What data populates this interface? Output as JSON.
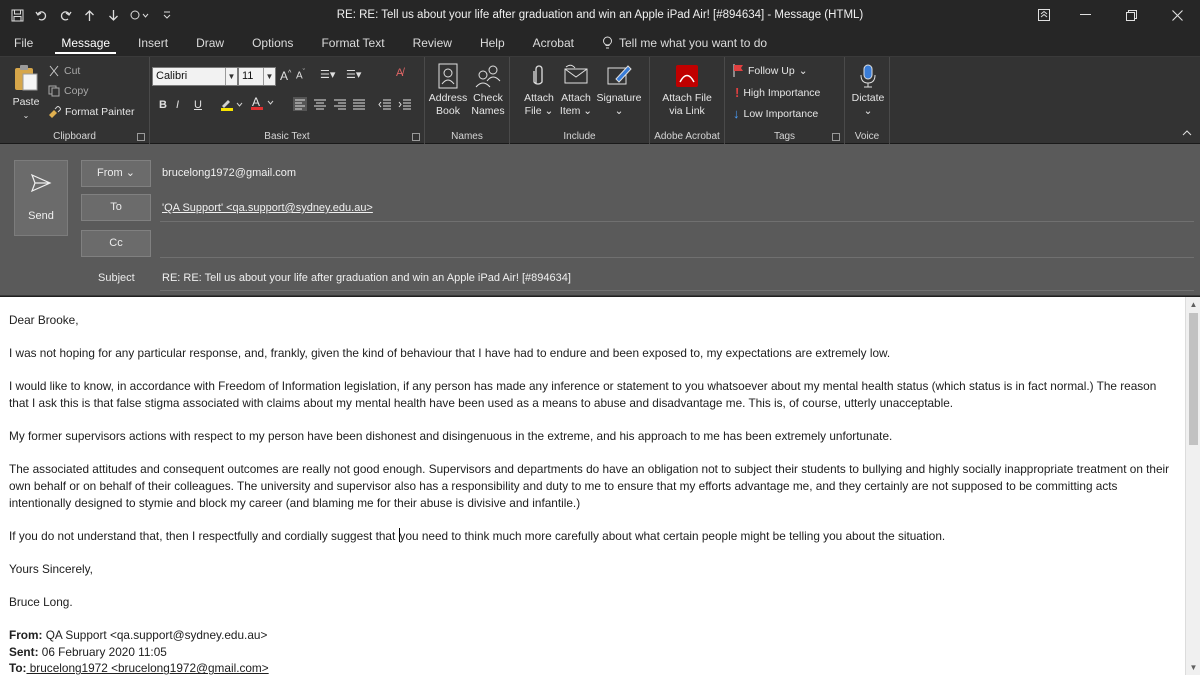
{
  "window": {
    "title": "RE: RE: Tell us about your life after graduation and win an Apple iPad Air! [#894634]  -  Message (HTML)"
  },
  "tabs": [
    "File",
    "Message",
    "Insert",
    "Draw",
    "Options",
    "Format Text",
    "Review",
    "Help",
    "Acrobat"
  ],
  "active_tab": "Message",
  "tell_me": "Tell me what you want to do",
  "ribbon": {
    "clipboard": {
      "paste": "Paste",
      "cut": "Cut",
      "copy": "Copy",
      "format_painter": "Format Painter",
      "label": "Clipboard"
    },
    "basic_text": {
      "font": "Calibri",
      "size": "11",
      "label": "Basic Text"
    },
    "names": {
      "address_book_1": "Address",
      "address_book_2": "Book",
      "check_names_1": "Check",
      "check_names_2": "Names",
      "label": "Names"
    },
    "include": {
      "attach_file_1": "Attach",
      "attach_file_2": "File",
      "attach_item_1": "Attach",
      "attach_item_2": "Item",
      "signature": "Signature",
      "label": "Include"
    },
    "adobe": {
      "attach_link_1": "Attach File",
      "attach_link_2": "via Link",
      "label": "Adobe Acrobat"
    },
    "tags": {
      "follow_up": "Follow Up",
      "high": "High Importance",
      "low": "Low Importance",
      "label": "Tags"
    },
    "voice": {
      "dictate": "Dictate",
      "label": "Voice"
    }
  },
  "header": {
    "send": "Send",
    "from_label": "From",
    "from_value": "brucelong1972@gmail.com",
    "to_label": "To",
    "to_value": "'QA Support' <qa.support@sydney.edu.au>",
    "cc_label": "Cc",
    "subject_label": "Subject",
    "subject_value": "RE: RE: Tell us about your life after graduation and win an Apple iPad Air! [#894634]"
  },
  "body": {
    "greeting": "Dear Brooke,",
    "p1": "I was not hoping for any particular response, and, frankly, given the kind of behaviour that I have had to endure and been exposed to, my expectations are extremely low.",
    "p2": "I would like to know, in accordance with Freedom of Information legislation, if any person has made any inference or statement to you whatsoever about my mental health status (which status is in fact normal.) The reason that I ask this is that false stigma associated with claims about my mental health have been used as a means to abuse and disadvantage me. This is, of course, utterly unacceptable.",
    "p3": "My former supervisors actions with respect to my person have been dishonest and disingenuous in the extreme, and his approach to me has been extremely unfortunate.",
    "p4": "The associated attitudes and consequent outcomes are really not good enough. Supervisors and departments do have an obligation not to subject their students to bullying and highly socially inappropriate treatment on their own behalf or on behalf of their colleagues. The university and supervisor also has a responsibility and duty to me to ensure that my efforts advantage me, and they certainly are not supposed to be committing acts intentionally designed to stymie and block my career (and blaming me for their abuse is divisive and infantile.)",
    "p5a": "If you do not understand that, then I respectfully and cordially suggest that ",
    "p5b": "you need to think much more carefully about what certain people might be telling you about the situation.",
    "closing": "Yours Sincerely,",
    "name": "Bruce Long.",
    "from_label": "From:",
    "from_value": " QA Support <qa.support@sydney.edu.au>",
    "sent_label": "Sent:",
    "sent_value": " 06 February 2020 11:05",
    "to_label": "To:",
    "to_value": " brucelong1972 <brucelong1972@gmail.com>"
  }
}
